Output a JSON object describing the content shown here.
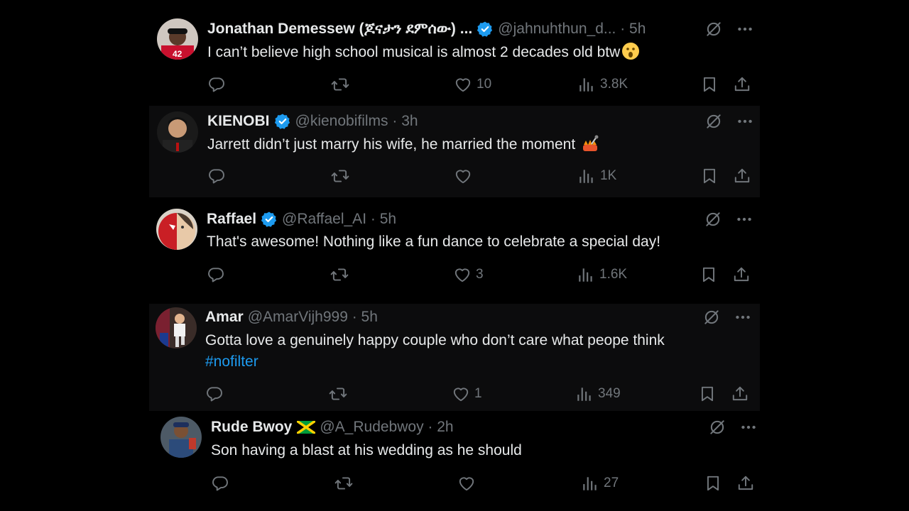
{
  "tweets": [
    {
      "name": "Jonathan Demessew (ጆናታን ደምሰው) ...",
      "handle": "@jahnuhthun_d... · 5h",
      "text": "I can’t believe high school musical is almost 2 decades old btw",
      "hashtag": "",
      "likes": "10",
      "views": "3.8K",
      "replies": "",
      "retweets": "",
      "verified": true,
      "emoji": "astonished-face"
    },
    {
      "name": "KIENOBI",
      "handle": "@kienobifilms · 3h",
      "text": "Jarrett didn’t just marry his wife, he married the moment",
      "hashtag": "",
      "likes": "",
      "views": "1K",
      "replies": "",
      "retweets": "",
      "verified": true,
      "emoji": "singer-hands"
    },
    {
      "name": "Raffael",
      "handle": "@Raffael_AI · 5h",
      "text": "That's awesome! Nothing like a fun dance to celebrate a special day!",
      "hashtag": "",
      "likes": "3",
      "views": "1.6K",
      "replies": "",
      "retweets": "",
      "verified": true,
      "emoji": ""
    },
    {
      "name": "Amar",
      "handle": "@AmarVijh999 · 5h",
      "text": "Gotta love a genuinely happy couple who don’t care what peope think",
      "hashtag": "#nofilter",
      "likes": "1",
      "views": "349",
      "replies": "",
      "retweets": "",
      "verified": false,
      "emoji": ""
    },
    {
      "name": "Rude Bwoy",
      "handle": "@A_Rudebwoy · 2h",
      "text": "Son having a blast at his wedding as he should",
      "hashtag": "",
      "likes": "",
      "views": "27",
      "replies": "",
      "retweets": "",
      "verified": false,
      "flag": "jamaica-flag"
    }
  ],
  "colors": {
    "background": "#000000",
    "text": "#e7e9ea",
    "muted": "#71767b",
    "link": "#1d9bf0",
    "verified": "#1d9bf0"
  }
}
